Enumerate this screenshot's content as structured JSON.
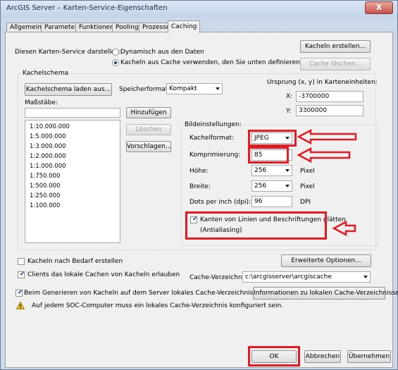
{
  "window": {
    "title": "ArcGIS Server – Karten-Service-Eigenschaften",
    "close": "X"
  },
  "tabs": [
    "Allgemein",
    "Parameter",
    "Funktionen",
    "Pooling",
    "Prozesse",
    "Caching"
  ],
  "display": {
    "label": "Diesen Karten-Service darstellen:",
    "option_dynamic": "Dynamisch aus den Daten",
    "option_cache": "Kacheln aus Cache verwenden, den Sie unten definieren",
    "create_tiles_button": "Kacheln erstellen...",
    "delete_cache_button": "Cache löschen..."
  },
  "tiling_scheme": {
    "group_label": "Kachelschema",
    "load_button": "Kachelschema laden aus...",
    "storage_label": "Speicherformat:",
    "storage_value": "Kompakt",
    "origin_label": "Ursprung (x, y) in Karteneinheiten:",
    "x_label": "X:",
    "x_value": "-3700000",
    "y_label": "Y:",
    "y_value": "3300000",
    "scales_label": "Maßstäbe:",
    "add_button": "Hinzufügen",
    "delete_button": "Löschen",
    "suggest_button": "Vorschlagen...",
    "scales": [
      "1:10.000.000",
      "1:5.000.000",
      "1:3.000.000",
      "1:2.000.000",
      "1:1.000.000",
      "1:750.000",
      "1:500.000",
      "1:250.000",
      "1:100.000"
    ]
  },
  "image_settings": {
    "group_label": "Bildeinstellungen:",
    "format_label": "Kachelformat:",
    "format_value": "JPEG",
    "compression_label": "Komprimierung:",
    "compression_value": "85",
    "height_label": "Höhe:",
    "height_value": "256",
    "height_unit": "Pixel",
    "width_label": "Breite:",
    "width_value": "256",
    "width_unit": "Pixel",
    "dpi_label": "Dots per inch (dpi):",
    "dpi_value": "96",
    "dpi_unit": "DPI",
    "antialias_line1": "Kanten von Linien und Beschriftungen glätten",
    "antialias_line2": "(Antialiasing)"
  },
  "options": {
    "on_demand": "Kacheln nach Bedarf erstellen",
    "local_cache": "Clients das lokale Cachen von Kacheln erlauben",
    "advanced_button": "Erweiterte Optionen...",
    "cache_dir_label": "Cache-Verzeichnis:",
    "cache_dir_value": "c:\\arcgisserver\\arcgiscache",
    "server_local_dir": "Beim Generieren von Kacheln auf dem Server lokales Cache-Verzeichnis verwenden:",
    "info_button": "Informationen zu lokalen Cache-Verzeichnissen",
    "warning_text": "Auf jedem SOC-Computer muss ein lokales Cache-Verzeichnis konfiguriert sein."
  },
  "footer": {
    "ok": "OK",
    "cancel": "Abbrechen",
    "apply": "Übernehmen"
  },
  "colors": {
    "annotation": "#e21b24",
    "title_bar": "#c2d4ea"
  }
}
